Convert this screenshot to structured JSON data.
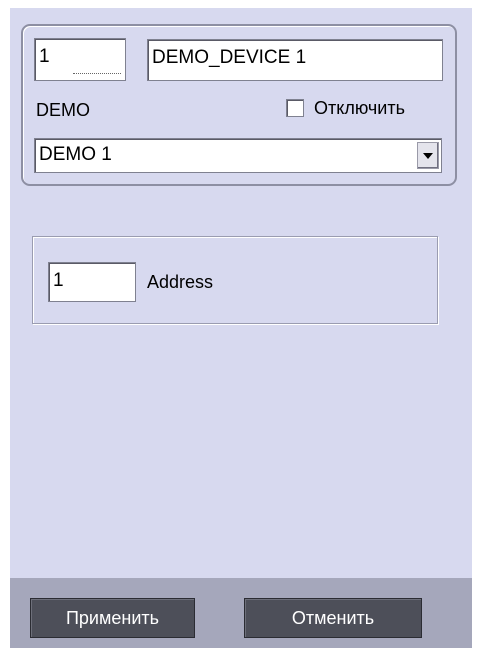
{
  "device": {
    "id": "1",
    "name": "DEMO_DEVICE 1",
    "type_label": "DEMO",
    "disable_label": "Отключить",
    "disable_checked": false,
    "model_selected": "DEMO 1"
  },
  "address": {
    "value": "1",
    "label": "Address"
  },
  "footer": {
    "apply_label": "Применить",
    "cancel_label": "Отменить"
  },
  "icons": {
    "dropdown": "chevron-down-icon"
  },
  "colors": {
    "panel_bg": "#d7d9ef",
    "footer_bg": "#a5a7bb",
    "button_bg": "#4d4f59"
  }
}
